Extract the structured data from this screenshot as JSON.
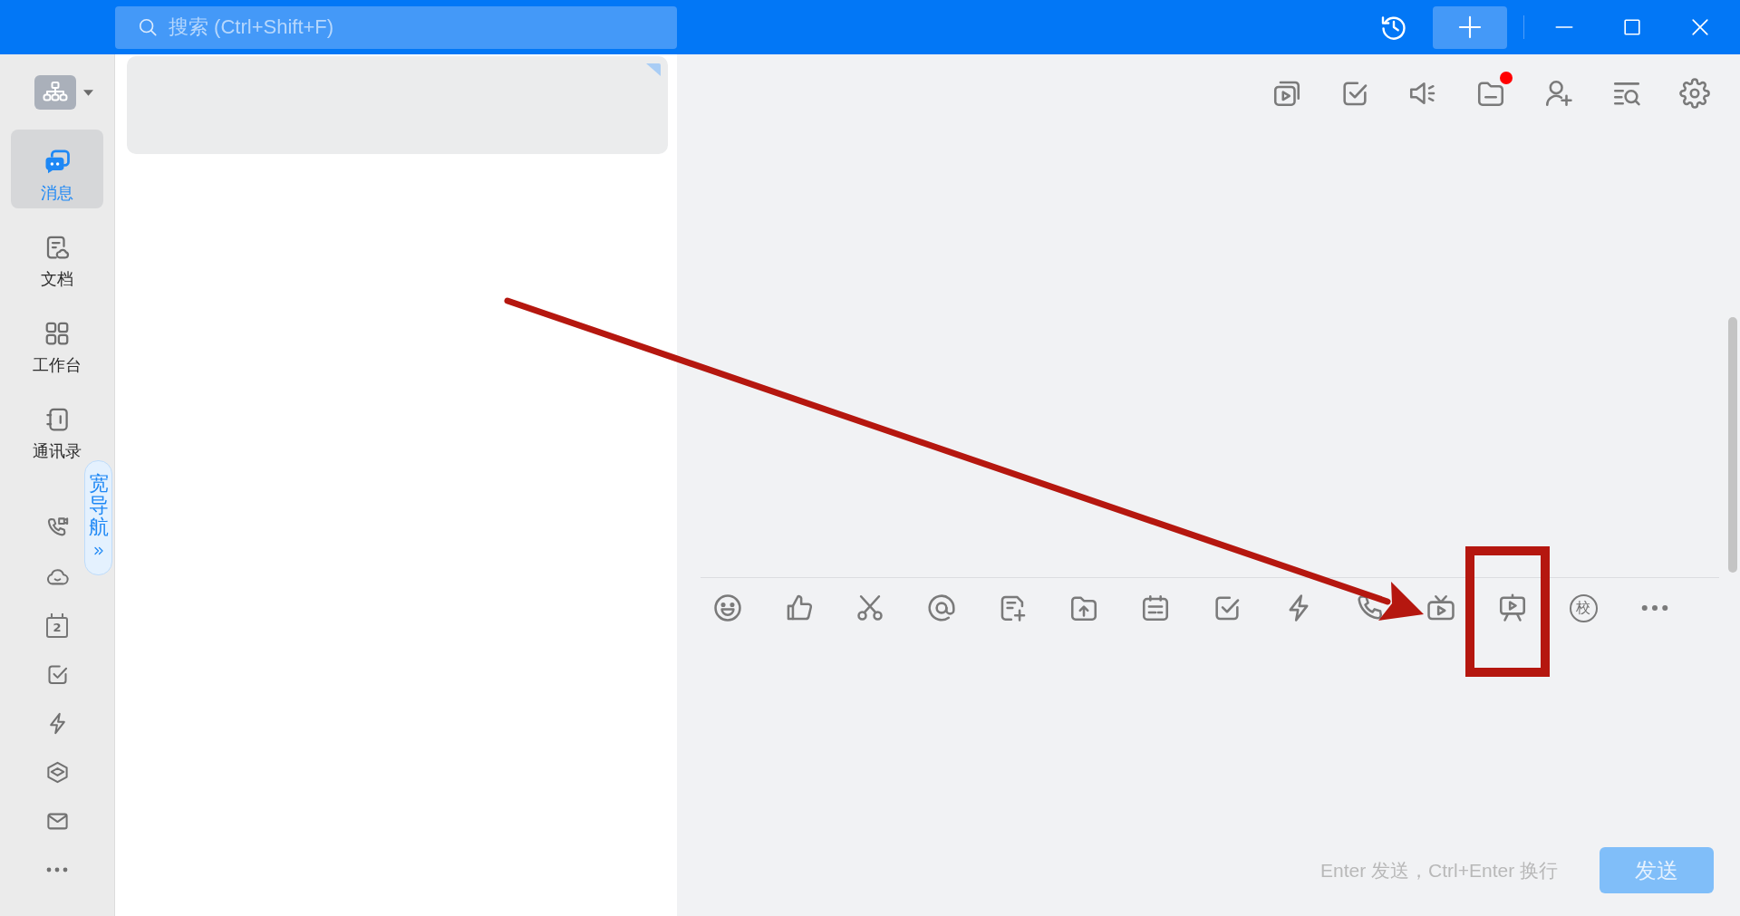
{
  "title_bar": {
    "search": {
      "placeholder": "搜索 (Ctrl+Shift+F)"
    }
  },
  "sidebar": {
    "nav_items": [
      {
        "label": "消息",
        "selected": true
      },
      {
        "label": "文档",
        "selected": false
      },
      {
        "label": "工作台",
        "selected": false
      },
      {
        "label": "通讯录",
        "selected": false
      }
    ],
    "calendar_day": "2",
    "wide_nav_tab": {
      "label": "宽导航"
    }
  },
  "chat_header": {
    "files_unread": true
  },
  "composer": {
    "proofread_char": "校",
    "hint": "Enter 发送，Ctrl+Enter 换行",
    "send_button": {
      "label": "发送",
      "disabled": true
    }
  }
}
